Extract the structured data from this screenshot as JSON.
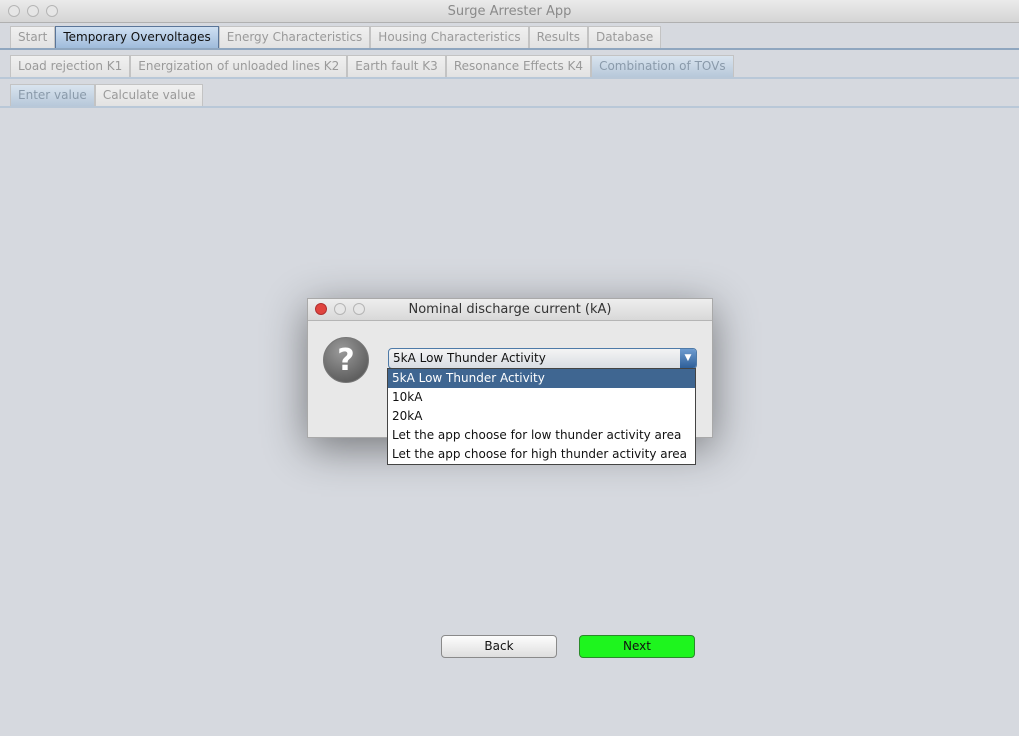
{
  "window": {
    "title": "Surge Arrester App"
  },
  "main_tabs": [
    "Start",
    "Temporary Overvoltages",
    "Energy Characteristics",
    "Housing Characteristics",
    "Results",
    "Database"
  ],
  "sub_tabs": [
    "Load rejection K1",
    "Energization of unloaded lines K2",
    "Earth fault K3",
    "Resonance Effects K4",
    "Combination of TOVs"
  ],
  "inner_tabs": [
    "Enter value",
    "Calculate value"
  ],
  "dialog": {
    "title": "Nominal discharge current (kA)",
    "icon": "question-icon",
    "selected": "5kA Low Thunder Activity",
    "options": [
      "5kA Low Thunder Activity",
      "10kA",
      "20kA",
      "Let the app choose for low thunder activity area",
      "Let the app choose for high thunder activity area"
    ]
  },
  "buttons": {
    "back": "Back",
    "next": "Next"
  },
  "colors": {
    "next": "#1ef51e",
    "selection": "#3f6691"
  }
}
